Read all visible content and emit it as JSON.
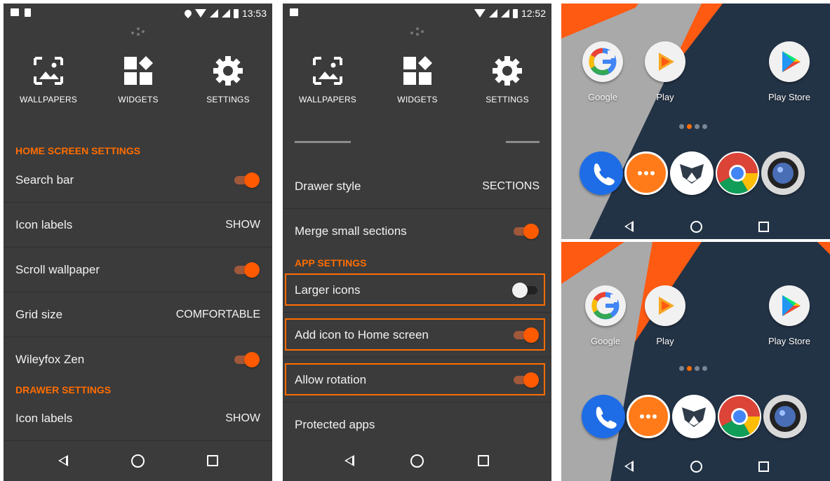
{
  "panel1": {
    "status": {
      "time": "13:53"
    },
    "menu": {
      "wallpapers": "WALLPAPERS",
      "widgets": "WIDGETS",
      "settings": "SETTINGS"
    },
    "section_home": "HOME SCREEN SETTINGS",
    "rows": [
      {
        "label": "Search bar"
      },
      {
        "label": "Icon labels",
        "value": "SHOW"
      },
      {
        "label": "Scroll wallpaper"
      },
      {
        "label": "Grid size",
        "value": "COMFORTABLE"
      },
      {
        "label": "Wileyfox Zen"
      }
    ],
    "section_drawer": "DRAWER SETTINGS",
    "drawer_row": {
      "label": "Icon labels",
      "value": "SHOW"
    }
  },
  "panel2": {
    "status": {
      "time": "12:52"
    },
    "menu": {
      "wallpapers": "WALLPAPERS",
      "widgets": "WIDGETS",
      "settings": "SETTINGS"
    },
    "rows_top": [
      {
        "label": "Drawer style",
        "value": "SECTIONS"
      },
      {
        "label": "Merge small sections"
      }
    ],
    "section_app": "APP SETTINGS",
    "rows_app": [
      {
        "label": "Larger icons"
      },
      {
        "label": "Add icon to Home screen"
      },
      {
        "label": "Allow rotation"
      },
      {
        "label": "Protected apps"
      }
    ]
  },
  "home": {
    "apps": [
      {
        "label": "Google"
      },
      {
        "label": "Play"
      },
      {
        "label": "Play Store"
      }
    ],
    "colors": {
      "accent": "#ff6d00",
      "bg": "#233346",
      "gray": "#a9a9a9"
    }
  },
  "colors": {
    "panel_bg": "#3b3b3b",
    "accent": "#ff6d00"
  }
}
